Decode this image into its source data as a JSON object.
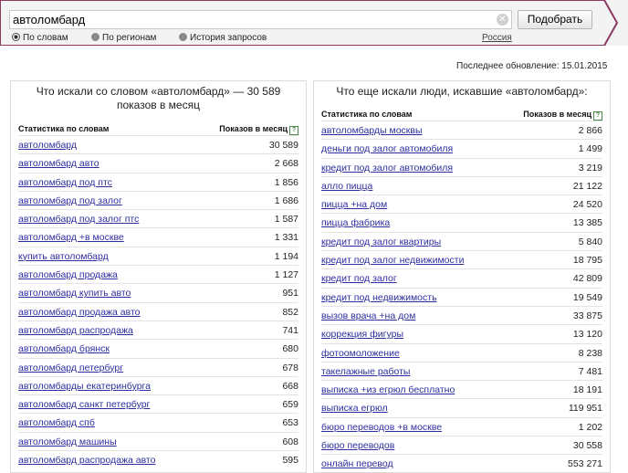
{
  "search": {
    "query": "автоломбард",
    "button_label": "Подобрать",
    "modes": [
      {
        "label": "По словам",
        "selected": true
      },
      {
        "label": "По регионам",
        "selected": false
      },
      {
        "label": "История запросов",
        "selected": false
      }
    ],
    "region": "Россия"
  },
  "last_update": "Последнее обновление: 15.01.2015",
  "left_panel": {
    "title": "Что искали со словом «автоломбард» — 30 589 показов в месяц",
    "col_words": "Статистика по словам",
    "col_shows": "Показов в месяц",
    "rows": [
      {
        "kw": "автоломбард",
        "count": "30 589"
      },
      {
        "kw": "автоломбард авто",
        "count": "2 668"
      },
      {
        "kw": "автоломбард под птс",
        "count": "1 856"
      },
      {
        "kw": "автоломбард под залог",
        "count": "1 686"
      },
      {
        "kw": "автоломбард под залог птс",
        "count": "1 587"
      },
      {
        "kw": "автоломбард +в москве",
        "count": "1 331"
      },
      {
        "kw": "купить автоломбард",
        "count": "1 194"
      },
      {
        "kw": "автоломбард продажа",
        "count": "1 127"
      },
      {
        "kw": "автоломбард купить авто",
        "count": "951"
      },
      {
        "kw": "автоломбард продажа авто",
        "count": "852"
      },
      {
        "kw": "автоломбард распродажа",
        "count": "741"
      },
      {
        "kw": "автоломбард брянск",
        "count": "680"
      },
      {
        "kw": "автоломбард петербург",
        "count": "678"
      },
      {
        "kw": "автоломбарды екатеринбурга",
        "count": "668"
      },
      {
        "kw": "автоломбард санкт петербург",
        "count": "659"
      },
      {
        "kw": "автоломбард спб",
        "count": "653"
      },
      {
        "kw": "автоломбард машины",
        "count": "608"
      },
      {
        "kw": "автоломбард распродажа авто",
        "count": "595"
      }
    ]
  },
  "right_panel": {
    "title": "Что еще искали люди, искавшие «автоломбард»:",
    "col_words": "Статистика по словам",
    "col_shows": "Показов в месяц",
    "rows": [
      {
        "kw": "автоломбарды москвы",
        "count": "2 866"
      },
      {
        "kw": "деньги под залог автомобиля",
        "count": "1 499"
      },
      {
        "kw": "кредит под залог автомобиля",
        "count": "3 219"
      },
      {
        "kw": "алло пицца",
        "count": "21 122"
      },
      {
        "kw": "пицца +на дом",
        "count": "24 520"
      },
      {
        "kw": "пицца фабрика",
        "count": "13 385"
      },
      {
        "kw": "кредит под залог квартиры",
        "count": "5 840"
      },
      {
        "kw": "кредит под залог недвижимости",
        "count": "18 795"
      },
      {
        "kw": "кредит под залог",
        "count": "42 809"
      },
      {
        "kw": "кредит под недвижимость",
        "count": "19 549"
      },
      {
        "kw": "вызов врача +на дом",
        "count": "33 875"
      },
      {
        "kw": "коррекция фигуры",
        "count": "13 120"
      },
      {
        "kw": "фотоомоложение",
        "count": "8 238"
      },
      {
        "kw": "такелажные работы",
        "count": "7 481"
      },
      {
        "kw": "выписка +из егрюл бесплатно",
        "count": "18 191"
      },
      {
        "kw": "выписка егрюл",
        "count": "119 951"
      },
      {
        "kw": "бюро переводов +в москве",
        "count": "1 202"
      },
      {
        "kw": "бюро переводов",
        "count": "30 558"
      },
      {
        "kw": "онлайн перевод",
        "count": "553 271"
      }
    ]
  },
  "colors": {
    "accent": "#8b3a62",
    "link": "#2e2ea0",
    "header_bg": "#f2f2f2"
  }
}
